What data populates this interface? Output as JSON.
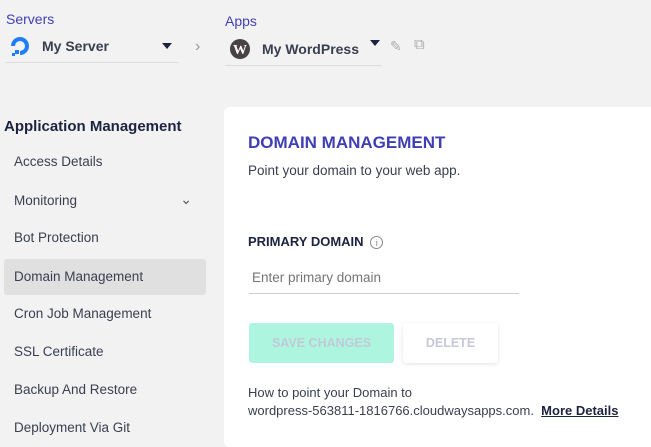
{
  "header": {
    "servers_label": "Servers",
    "server_name": "My Server",
    "apps_label": "Apps",
    "app_name": "My WordPress"
  },
  "sidebar": {
    "title": "Application Management",
    "items": [
      {
        "label": "Access Details"
      },
      {
        "label": "Monitoring"
      },
      {
        "label": "Bot Protection"
      },
      {
        "label": "Domain Management",
        "active": true
      },
      {
        "label": "Cron Job Management"
      },
      {
        "label": "SSL Certificate"
      },
      {
        "label": "Backup And Restore"
      },
      {
        "label": "Deployment Via Git"
      }
    ]
  },
  "main": {
    "title": "DOMAIN MANAGEMENT",
    "subtitle": "Point your domain to your web app.",
    "field_label": "PRIMARY DOMAIN",
    "placeholder": "Enter primary domain",
    "save_label": "SAVE CHANGES",
    "delete_label": "DELETE",
    "help_line1": "How to point your Domain to",
    "help_line2": "wordpress-563811-1816766.cloudwaysapps.com.",
    "more_details": "More Details"
  },
  "colors": {
    "accent": "#3f3fb5",
    "save_bg": "#aef5e0"
  }
}
